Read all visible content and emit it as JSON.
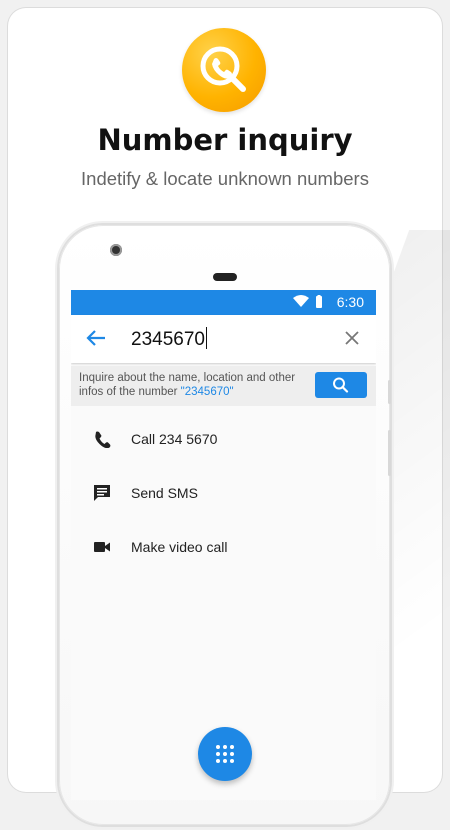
{
  "header": {
    "title": "Number inquiry",
    "subtitle": "Indetify & locate unknown numbers"
  },
  "phone": {
    "status_bar": {
      "time": "6:30"
    },
    "search": {
      "query": "2345670"
    },
    "inquire_banner": {
      "text_prefix": "Inquire about the name, location and other infos of the number ",
      "number_quoted": "\"2345670\""
    },
    "actions": [
      {
        "icon": "phone-icon",
        "label": "Call 234 5670"
      },
      {
        "icon": "sms-icon",
        "label": "Send SMS"
      },
      {
        "icon": "video-camera-icon",
        "label": "Make video call"
      }
    ]
  },
  "colors": {
    "accent": "#1e88e5",
    "logo": "#ffb300"
  }
}
